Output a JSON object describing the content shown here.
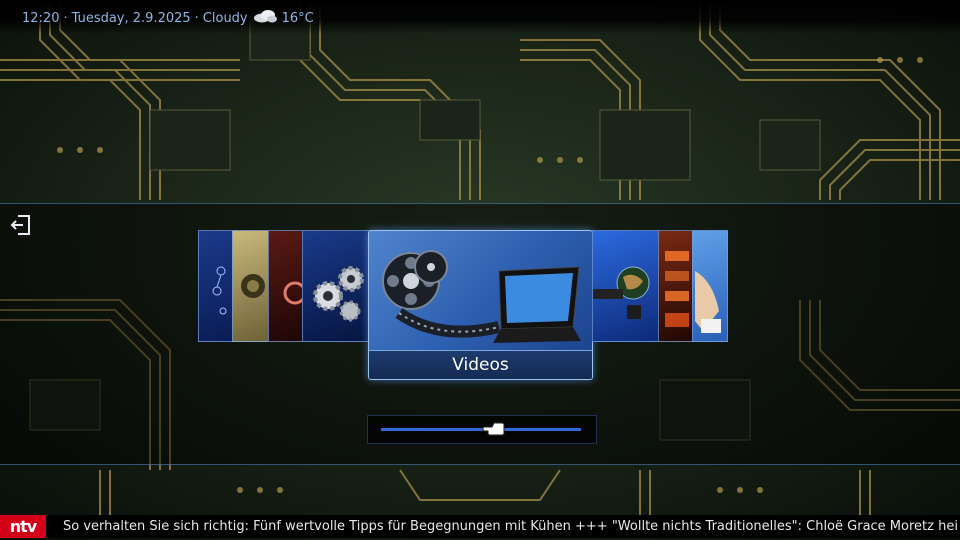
{
  "status_bar": {
    "time": "12:20",
    "separator": "·",
    "date": "Tuesday, 2.9.2025",
    "weather_condition": "Cloudy",
    "weather_icon": "cloudy-icon",
    "temperature": "16°C"
  },
  "menu": {
    "focused_item": "Videos",
    "left_items": [
      "network-thumb",
      "speaker-thumb",
      "music-thumb",
      "gears-thumb"
    ],
    "right_items": [
      "globe-thumb",
      "clock-thumb",
      "hand-thumb"
    ]
  },
  "ticker": {
    "logo": "ntv",
    "text": "So verhalten Sie sich richtig: Fünf wertvolle Tipps für Begegnungen mit Kühen +++ \"Wollte nichts Traditionelles\": Chloë Grace Moretz hei"
  },
  "colors": {
    "accent_blue": "#2f6bd8",
    "status_text": "#8fb6e4",
    "ntv_red": "#d4001a",
    "board_green": "#1c2a1a",
    "trace_gold": "#b59a4a"
  }
}
